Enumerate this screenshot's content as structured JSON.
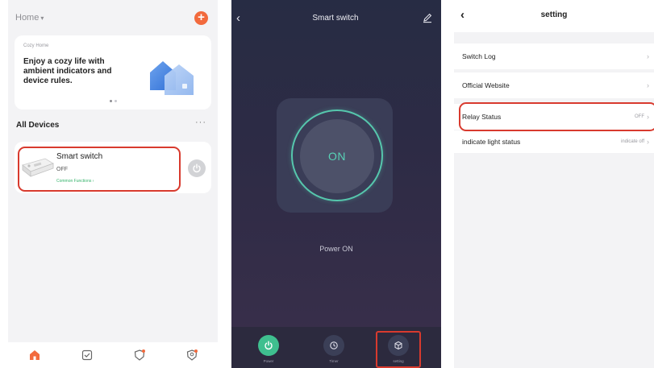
{
  "home": {
    "title": "Home",
    "banner_small": "Cozy Home",
    "banner_text": "Enjoy a cozy life with ambient indicators and device rules.",
    "section_title": "All Devices",
    "section_more": "···",
    "device": {
      "name": "Smart switch",
      "status": "OFF",
      "functions": "Common Functions"
    }
  },
  "control": {
    "title": "Smart switch",
    "dial_label": "ON",
    "power_text": "Power ON",
    "buttons": [
      {
        "label": "Power"
      },
      {
        "label": "Timer"
      },
      {
        "label": "setting"
      }
    ]
  },
  "settings": {
    "title": "setting",
    "rows": [
      {
        "label": "Switch Log",
        "value": ""
      },
      {
        "label": "Official Website",
        "value": ""
      },
      {
        "label": "Relay Status",
        "value": "OFF"
      },
      {
        "label": "indicate light status",
        "value": "indicate off"
      }
    ]
  },
  "colors": {
    "accent_orange": "#f26a3d",
    "highlight_red": "#d83a2e",
    "dial_teal": "#56c7ad",
    "power_green": "#3fbf8f"
  }
}
